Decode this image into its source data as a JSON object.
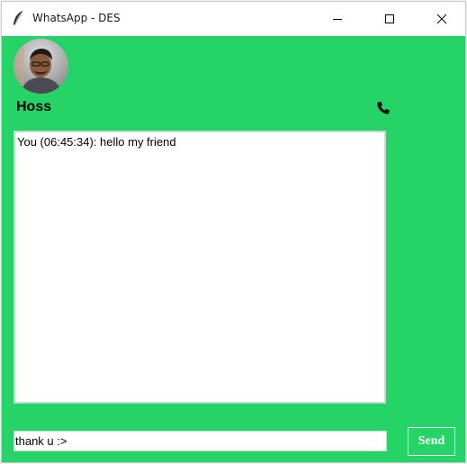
{
  "window": {
    "title": "WhatsApp - DES",
    "icons": {
      "app": "feather-icon",
      "minimize": "minimize-icon",
      "maximize": "maximize-icon",
      "close": "close-icon"
    }
  },
  "contact": {
    "name": "Hoss",
    "avatar_icon": "avatar-photo",
    "call_icon": "phone-icon"
  },
  "chat": {
    "messages": [
      "You (06:45:34): hello my friend"
    ]
  },
  "composer": {
    "input_value": "thank u :>",
    "send_label": "Send"
  },
  "colors": {
    "background": "#25d366",
    "panel": "#ffffff",
    "send_text": "#ffffff"
  }
}
